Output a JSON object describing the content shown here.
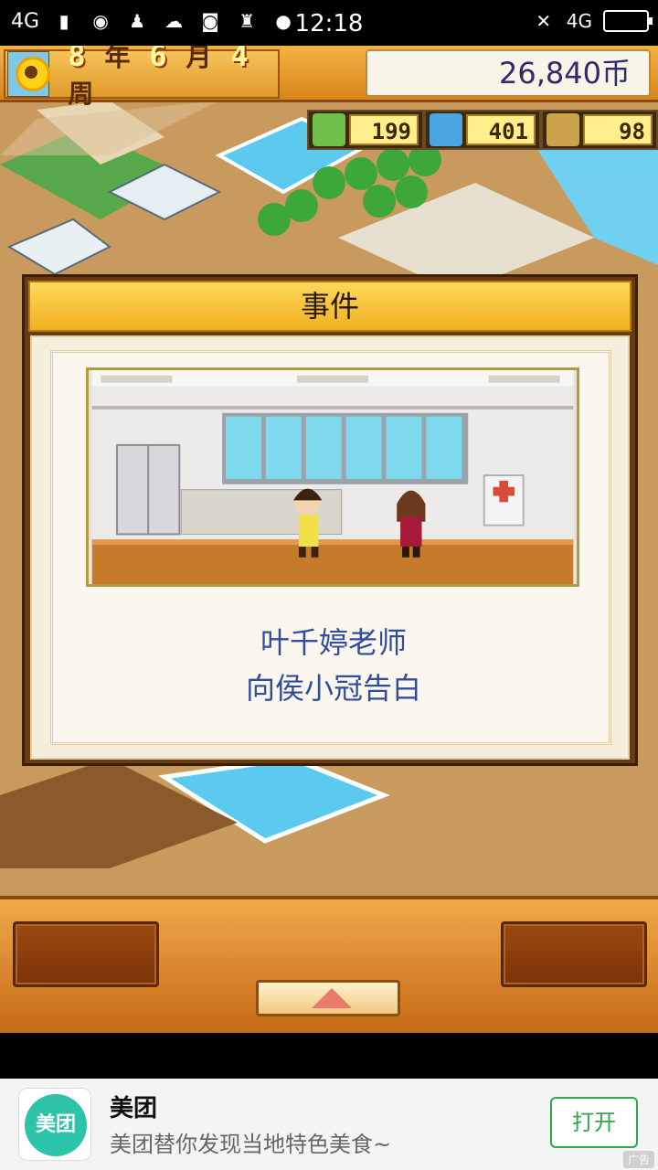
{
  "status_bar": {
    "network": "4G",
    "network_right": "4G",
    "time": "12:18",
    "icons": [
      "signal-icon",
      "weibo-icon",
      "qq-icon",
      "wechat-icon",
      "camera-icon",
      "android-icon",
      "message-icon",
      "mute-icon",
      "battery-icon"
    ]
  },
  "hud": {
    "year": "8",
    "year_unit": "年",
    "month": "6",
    "month_unit": "月",
    "week": "4",
    "week_unit": "周",
    "money": "26,840币",
    "resources": [
      {
        "icon": "pencil-icon",
        "value": "199"
      },
      {
        "icon": "flask-icon",
        "value": "401"
      },
      {
        "icon": "trophy-icon",
        "value": "98"
      }
    ]
  },
  "event": {
    "title": "事件",
    "line1": "叶千婷老师",
    "line2": "向侯小冠告白"
  },
  "ad": {
    "brand_logo_text": "美团",
    "title": "美团",
    "description": "美团替你发现当地特色美食~",
    "button": "打开",
    "tag": "广告"
  },
  "colors": {
    "accent": "#f0b020",
    "event_text": "#2f4d9c",
    "ad_button": "#2caa48"
  }
}
